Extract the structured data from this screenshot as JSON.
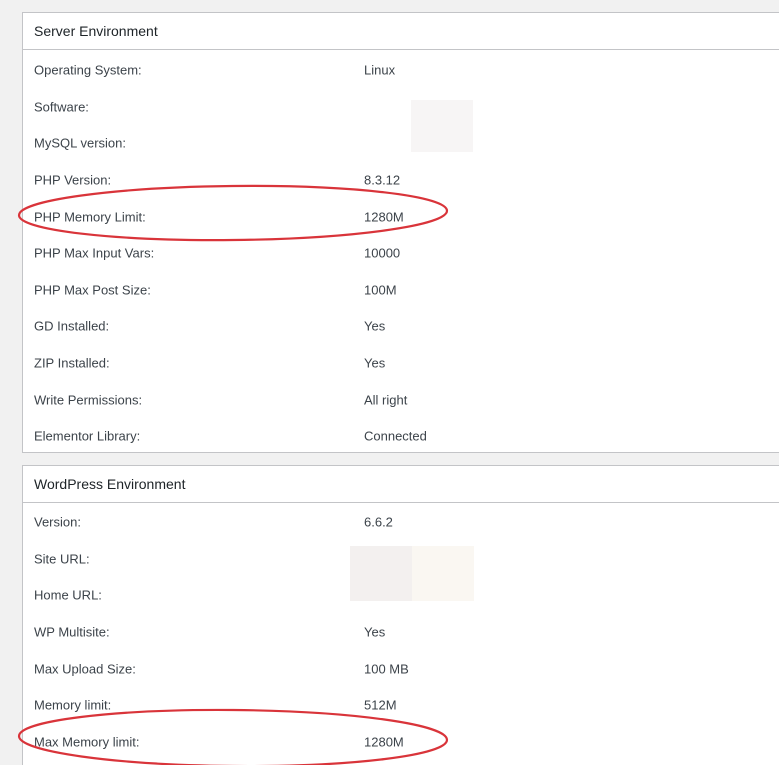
{
  "server_environment": {
    "title": "Server Environment",
    "rows": [
      {
        "label": "Operating System:",
        "value": "Linux"
      },
      {
        "label": "Software:",
        "value": ""
      },
      {
        "label": "MySQL version:",
        "value": ""
      },
      {
        "label": "PHP Version:",
        "value": "8.3.12"
      },
      {
        "label": "PHP Memory Limit:",
        "value": "1280M"
      },
      {
        "label": "PHP Max Input Vars:",
        "value": "10000"
      },
      {
        "label": "PHP Max Post Size:",
        "value": "100M"
      },
      {
        "label": "GD Installed:",
        "value": "Yes"
      },
      {
        "label": "ZIP Installed:",
        "value": "Yes"
      },
      {
        "label": "Write Permissions:",
        "value": "All right"
      },
      {
        "label": "Elementor Library:",
        "value": "Connected"
      }
    ]
  },
  "wordpress_environment": {
    "title": "WordPress Environment",
    "rows": [
      {
        "label": "Version:",
        "value": "6.6.2"
      },
      {
        "label": "Site URL:",
        "value": ""
      },
      {
        "label": "Home URL:",
        "value": ""
      },
      {
        "label": "WP Multisite:",
        "value": "Yes"
      },
      {
        "label": "Max Upload Size:",
        "value": "100 MB"
      },
      {
        "label": "Memory limit:",
        "value": "512M"
      },
      {
        "label": "Max Memory limit:",
        "value": "1280M"
      }
    ]
  },
  "colors": {
    "annotation_circle": "#d9343a",
    "panel_border": "#c3c4c7",
    "page_background": "#f1f1f1"
  }
}
